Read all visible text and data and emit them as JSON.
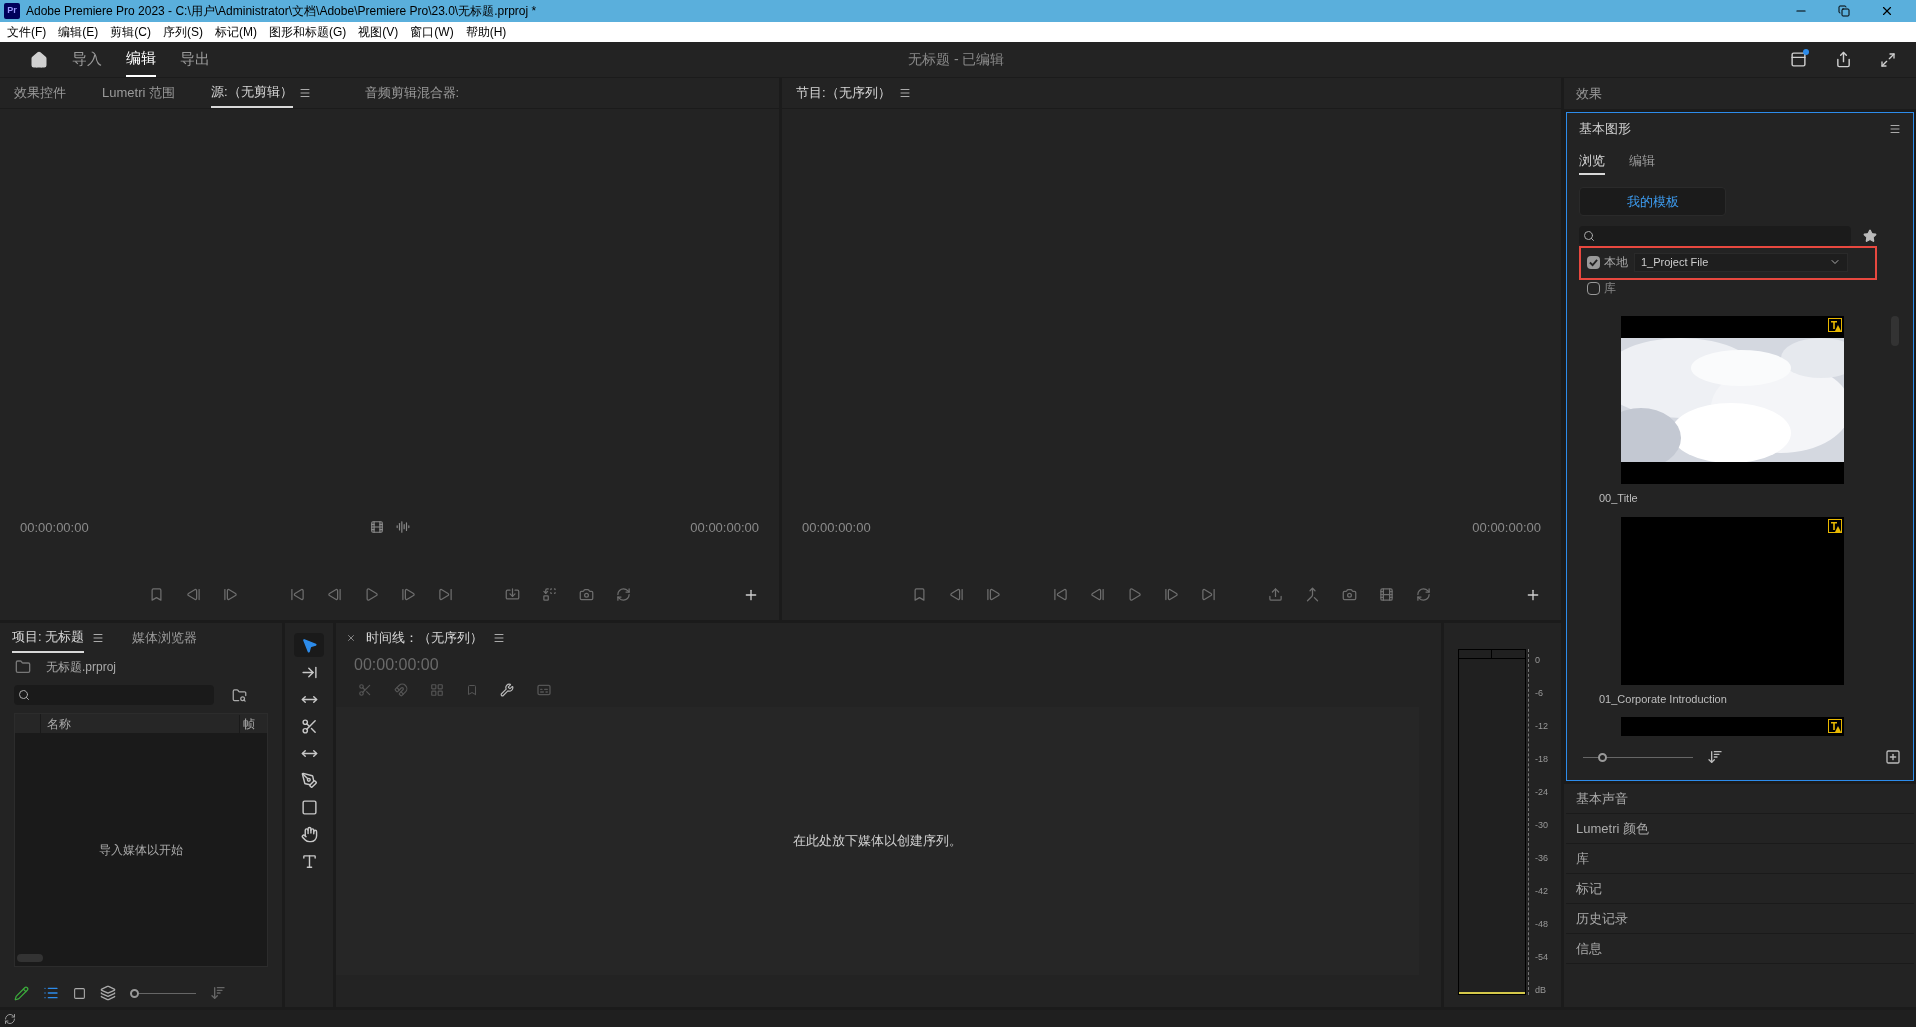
{
  "window": {
    "title": "Adobe Premiere Pro 2023 - C:\\用户\\Administrator\\文档\\Adobe\\Premiere Pro\\23.0\\无标题.prproj *",
    "app_badge": "Pr"
  },
  "menu": [
    "文件(F)",
    "编辑(E)",
    "剪辑(C)",
    "序列(S)",
    "标记(M)",
    "图形和标题(G)",
    "视图(V)",
    "窗口(W)",
    "帮助(H)"
  ],
  "workspace": {
    "tabs": [
      {
        "label": "导入",
        "selected": false
      },
      {
        "label": "编辑",
        "selected": true
      },
      {
        "label": "导出",
        "selected": false
      }
    ],
    "doc_title": "无标题 - 已编辑"
  },
  "source_panel": {
    "tabs": [
      {
        "label": "效果控件",
        "selected": false
      },
      {
        "label": "Lumetri 范围",
        "selected": false
      },
      {
        "label": "源:（无剪辑）",
        "selected": true
      },
      {
        "label": "音频剪辑混合器:",
        "selected": false
      }
    ],
    "timecode_left": "00:00:00:00",
    "timecode_right": "00:00:00:00"
  },
  "program_panel": {
    "title": "节目:（无序列）",
    "timecode_left": "00:00:00:00",
    "timecode_right": "00:00:00:00"
  },
  "effects_header": "效果",
  "essential_graphics": {
    "title": "基本图形",
    "tabs": [
      {
        "label": "浏览",
        "selected": true
      },
      {
        "label": "编辑",
        "selected": false
      }
    ],
    "my_templates_button": "我的模板",
    "local": {
      "label": "本地",
      "checked": true,
      "value": "1_Project File"
    },
    "library": {
      "label": "库",
      "checked": false
    },
    "thumbnail_size": {
      "level": 0.15
    },
    "templates": [
      {
        "kind": "picture",
        "name": "00_Title"
      },
      {
        "kind": "black",
        "name": "01_Corporate Introduction"
      },
      {
        "kind": "black"
      }
    ]
  },
  "collapsed_panels": [
    "基本声音",
    "Lumetri 颜色",
    "库",
    "标记",
    "历史记录",
    "信息"
  ],
  "project_panel": {
    "tabs": [
      {
        "label": "项目: 无标题",
        "selected": true
      },
      {
        "label": "媒体浏览器",
        "selected": false
      }
    ],
    "file": "无标题.prproj",
    "columns": [
      "名称",
      "帧"
    ],
    "empty_message": "导入媒体以开始",
    "zoom": {
      "level": 0
    }
  },
  "tools": [
    {
      "kind": "select",
      "selected": true
    },
    {
      "kind": "track",
      "selected": false
    },
    {
      "kind": "ripple",
      "selected": false
    },
    {
      "kind": "razor",
      "selected": false
    },
    {
      "kind": "slip",
      "selected": false
    },
    {
      "kind": "pen",
      "selected": false
    },
    {
      "kind": "rect",
      "selected": false
    },
    {
      "kind": "hand",
      "selected": false
    },
    {
      "kind": "type",
      "selected": false
    }
  ],
  "timeline": {
    "title": "时间线：（无序列）",
    "timecode": "00:00:00:00",
    "drop_message": "在此处放下媒体以创建序列。"
  },
  "meter": {
    "scale": [
      "0",
      "-6",
      "-12",
      "-18",
      "-24",
      "-30",
      "-36",
      "-42",
      "-48",
      "-54",
      "dB"
    ]
  }
}
